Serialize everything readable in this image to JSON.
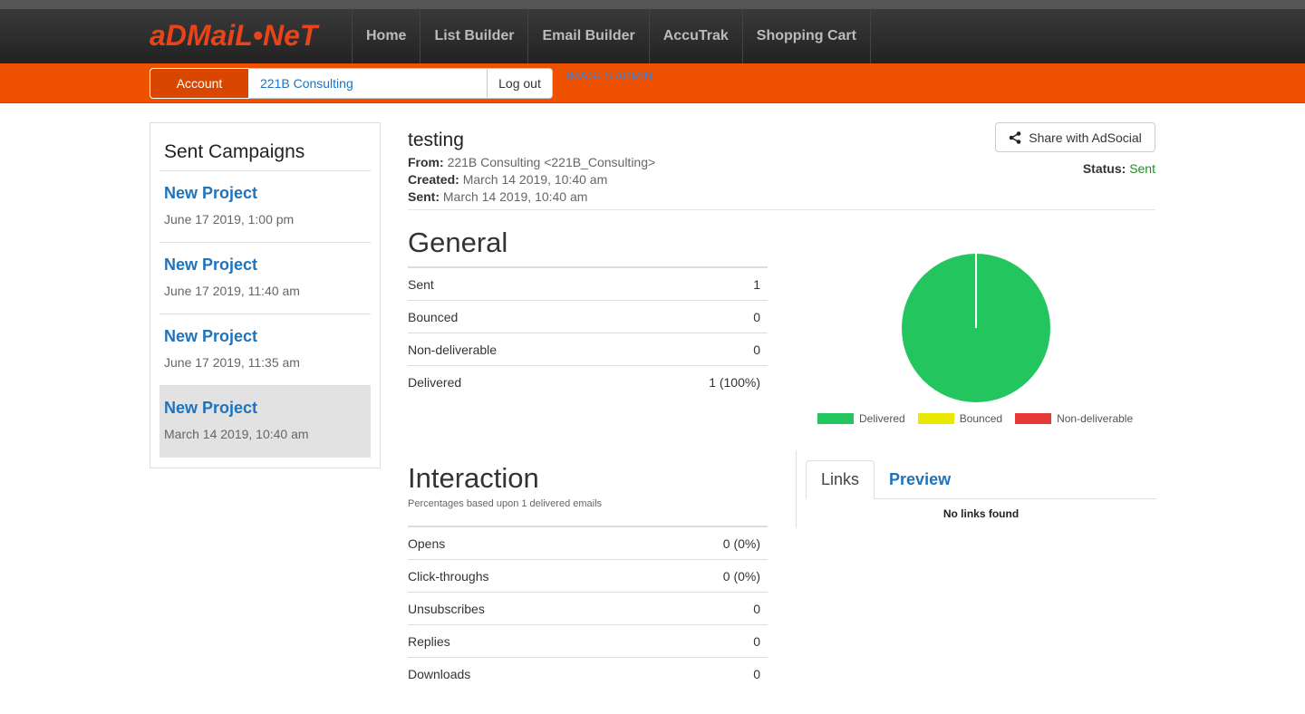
{
  "brand": {
    "logo_text": "aDMaiL•NeT"
  },
  "nav": {
    "items": [
      "Home",
      "List Builder",
      "Email Builder",
      "AccuTrak",
      "Shopping Cart"
    ]
  },
  "account_bar": {
    "account_label": "Account",
    "account_name": "221B Consulting",
    "logout_label": "Log out",
    "admin_link": "IMAGES ADMIN"
  },
  "sidebar": {
    "title": "Sent Campaigns",
    "items": [
      {
        "title": "New Project",
        "date": "June 17 2019, 1:00 pm"
      },
      {
        "title": "New Project",
        "date": "June 17 2019, 11:40 am"
      },
      {
        "title": "New Project",
        "date": "June 17 2019, 11:35 am"
      },
      {
        "title": "New Project",
        "date": "March 14 2019, 10:40 am"
      }
    ]
  },
  "campaign": {
    "title": "testing",
    "from_label": "From:",
    "from_value": "221B Consulting <221B_Consulting>",
    "created_label": "Created:",
    "created_value": "March 14 2019, 10:40 am",
    "sent_label": "Sent:",
    "sent_value": "March 14 2019, 10:40 am",
    "share_label": "Share with AdSocial",
    "status_label": "Status:",
    "status_value": "Sent"
  },
  "general": {
    "heading": "General",
    "rows": [
      {
        "label": "Sent",
        "value": "1"
      },
      {
        "label": "Bounced",
        "value": "0"
      },
      {
        "label": "Non-deliverable",
        "value": "0"
      },
      {
        "label": "Delivered",
        "value": "1 (100%)"
      }
    ]
  },
  "chart_data": {
    "type": "pie",
    "categories": [
      "Delivered",
      "Bounced",
      "Non-deliverable"
    ],
    "values": [
      1,
      0,
      0
    ],
    "colors": [
      "#22c55e",
      "#e8e800",
      "#e53935"
    ],
    "legend": "bottom"
  },
  "interaction": {
    "heading": "Interaction",
    "note": "Percentages based upon 1 delivered emails",
    "rows": [
      {
        "label": "Opens",
        "value": "0 (0%)"
      },
      {
        "label": "Click-throughs",
        "value": "0 (0%)"
      },
      {
        "label": "Unsubscribes",
        "value": "0"
      },
      {
        "label": "Replies",
        "value": "0"
      },
      {
        "label": "Downloads",
        "value": "0"
      }
    ]
  },
  "tabs": {
    "items": [
      "Links",
      "Preview"
    ],
    "empty_message": "No links found"
  }
}
